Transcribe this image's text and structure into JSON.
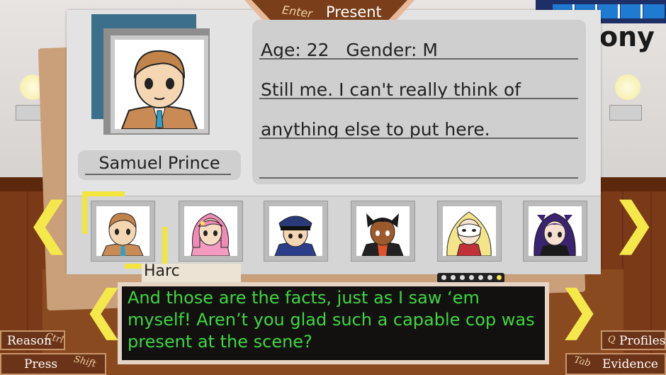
{
  "present_tab": {
    "key": "Enter",
    "label": "Present"
  },
  "title_fragment": "ony",
  "profile": {
    "name": "Samuel Prince",
    "line1": "Age: 22   Gender: M",
    "line2": "Still me. I can't really think of",
    "line3": "anything else to put here."
  },
  "roster": [
    "portrait-samuel-prince",
    "portrait-pink-hair",
    "portrait-police-cap",
    "portrait-dark-horned",
    "portrait-blonde-mask",
    "portrait-purple-hair"
  ],
  "nameplate": "Harc",
  "dialogue": "And those are the facts, just as I saw ‘em myself! Aren’t you glad such a capable cop was present at the scene?",
  "buttons": {
    "reason_label": "Reason",
    "reason_key": "Ctrl",
    "press_label": "Press",
    "press_key": "Shift",
    "profiles_label": "Profiles",
    "profiles_key": "Q",
    "evidence_label": "Evidence",
    "evidence_key": "Tab"
  },
  "colors": {
    "dialogue_text": "#3fd640",
    "arrow": "#f5e84b",
    "selection": "#f2e53b"
  }
}
